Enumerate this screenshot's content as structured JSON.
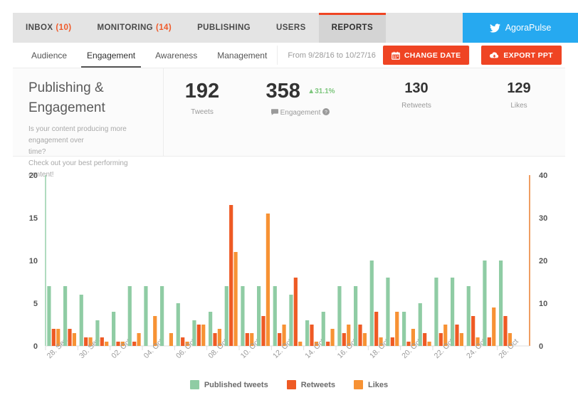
{
  "topnav": {
    "tabs": [
      {
        "label": "INBOX",
        "count": "(10)",
        "active": false
      },
      {
        "label": "MONITORING",
        "count": "(14)",
        "active": false
      },
      {
        "label": "PUBLISHING",
        "count": "",
        "active": false
      },
      {
        "label": "USERS",
        "count": "",
        "active": false
      },
      {
        "label": "REPORTS",
        "count": "",
        "active": true
      }
    ],
    "brand": "AgoraPulse",
    "brand_icon": "twitter-bird-icon",
    "brand_color": "#26a9f0",
    "accent_color": "#ef4423"
  },
  "subnav": {
    "tabs": [
      {
        "label": "Audience",
        "active": false
      },
      {
        "label": "Engagement",
        "active": true
      },
      {
        "label": "Awareness",
        "active": false
      },
      {
        "label": "Management",
        "active": false
      }
    ],
    "date_range": "From 9/28/16 to 10/27/16",
    "change_date_label": "CHANGE DATE",
    "change_date_icon": "calendar-icon",
    "export_label": "EXPORT PPT",
    "export_icon": "cloud-download-icon"
  },
  "summary": {
    "title_line1": "Publishing &",
    "title_line2": "Engagement",
    "sub_line1": "Is your content producing more engagement over",
    "sub_line2": "time?",
    "sub_line3": "Check out your best performing content!",
    "kpis": [
      {
        "value": "192",
        "label": "Tweets",
        "delta": "",
        "icon": ""
      },
      {
        "value": "358",
        "label": "Engagement",
        "delta": "31.1%",
        "delta_dir": "up",
        "delta_color": "#7dc67d",
        "icon": "engagement-icon",
        "help_icon": "help-circle-icon"
      },
      {
        "value": "130",
        "label": "Retweets",
        "delta": "",
        "icon": ""
      },
      {
        "value": "129",
        "label": "Likes",
        "delta": "",
        "icon": ""
      }
    ]
  },
  "chart_data": {
    "type": "bar",
    "title": "",
    "xlabel": "",
    "ylabel": "",
    "grid": false,
    "legend_position": "bottom",
    "y_left": {
      "label": "",
      "min": 0,
      "max": 20,
      "ticks": [
        0,
        5,
        10,
        15,
        20
      ],
      "color": "#8fcca4"
    },
    "y_right": {
      "label": "",
      "min": 0,
      "max": 40,
      "ticks": [
        0,
        10,
        20,
        30,
        40
      ],
      "color": "#e8751f"
    },
    "x_tick_labels": [
      "28. Sep",
      "30. Sep",
      "02. Oct",
      "04. Oct",
      "06. Oct",
      "08. Oct",
      "10. Oct",
      "12. Oct",
      "14. Oct",
      "16. Oct",
      "18. Oct",
      "20. Oct",
      "22. Oct",
      "24. Oct",
      "26. Oct"
    ],
    "x_tick_every": 2,
    "categories": [
      "28. Sep",
      "29. Sep",
      "30. Sep",
      "01. Oct",
      "02. Oct",
      "03. Oct",
      "04. Oct",
      "05. Oct",
      "06. Oct",
      "07. Oct",
      "08. Oct",
      "09. Oct",
      "10. Oct",
      "11. Oct",
      "12. Oct",
      "13. Oct",
      "14. Oct",
      "15. Oct",
      "16. Oct",
      "17. Oct",
      "18. Oct",
      "19. Oct",
      "20. Oct",
      "21. Oct",
      "22. Oct",
      "23. Oct",
      "24. Oct",
      "25. Oct",
      "26. Oct",
      "27. Oct"
    ],
    "series": [
      {
        "name": "Published tweets",
        "color": "#8fcca4",
        "axis": "left",
        "values": [
          7,
          7,
          6,
          3,
          4,
          7,
          7,
          7,
          5,
          3,
          4,
          7,
          7,
          7,
          7,
          6,
          3,
          4,
          7,
          7,
          10,
          8,
          4,
          5,
          8,
          8,
          7,
          10,
          10,
          0
        ]
      },
      {
        "name": "Retweets",
        "color": "#ee5a24",
        "axis": "right",
        "values": [
          4,
          4,
          2,
          2,
          1,
          1,
          0,
          0,
          2,
          5,
          3,
          33,
          3,
          7,
          3,
          16,
          5,
          1,
          3,
          5,
          8,
          2,
          1,
          3,
          3,
          5,
          7,
          2,
          7,
          0
        ]
      },
      {
        "name": "Likes",
        "color": "#f79234",
        "axis": "right",
        "values": [
          4,
          3,
          2,
          1,
          1,
          3,
          7,
          3,
          1,
          5,
          4,
          22,
          3,
          31,
          5,
          1,
          1,
          4,
          5,
          3,
          2,
          8,
          4,
          1,
          5,
          3,
          2,
          9,
          3,
          0
        ]
      }
    ],
    "legend": [
      {
        "name": "Published tweets",
        "color": "#8fcca4"
      },
      {
        "name": "Retweets",
        "color": "#ee5a24"
      },
      {
        "name": "Likes",
        "color": "#f79234"
      }
    ]
  }
}
